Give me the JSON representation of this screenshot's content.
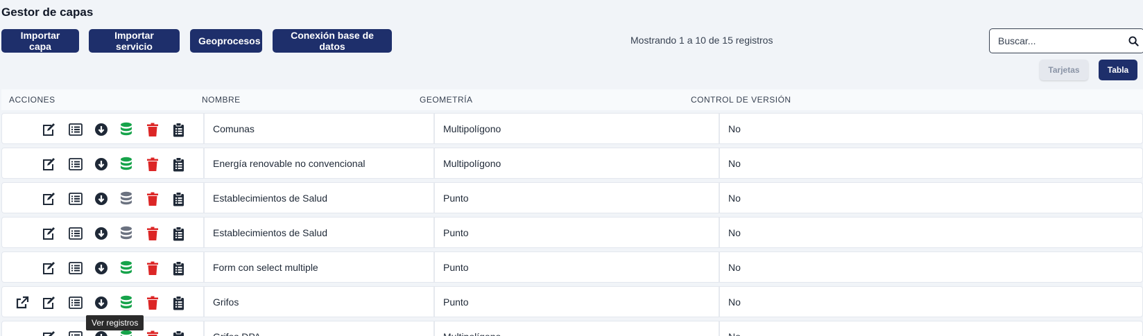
{
  "header": {
    "title": "Gestor de capas"
  },
  "toolbar": {
    "import_layer": "Importar capa",
    "import_service": "Importar servicio",
    "geoprocesses": "Geoprocesos",
    "db_connection": "Conexión base de datos"
  },
  "records_info": "Mostrando 1 a 10 de 15 registros",
  "search": {
    "placeholder": "Buscar...",
    "value": ""
  },
  "view_toggle": {
    "cards": "Tarjetas",
    "table": "Tabla"
  },
  "table": {
    "columns": [
      "ACCIONES",
      "NOMBRE",
      "GEOMETRÍA",
      "CONTROL DE VERSIÓN"
    ],
    "rows": [
      {
        "name": "Comunas",
        "geometry": "Multipolígono",
        "version_control": "No",
        "db_status": "active",
        "external_link": false
      },
      {
        "name": "Energía renovable no convencional",
        "geometry": "Multipolígono",
        "version_control": "No",
        "db_status": "active",
        "external_link": false
      },
      {
        "name": "Establecimientos de Salud",
        "geometry": "Punto",
        "version_control": "No",
        "db_status": "inactive",
        "external_link": false
      },
      {
        "name": "Establecimientos de Salud",
        "geometry": "Punto",
        "version_control": "No",
        "db_status": "inactive",
        "external_link": false
      },
      {
        "name": "Form con select multiple",
        "geometry": "Punto",
        "version_control": "No",
        "db_status": "active",
        "external_link": false
      },
      {
        "name": "Grifos",
        "geometry": "Punto",
        "version_control": "No",
        "db_status": "active",
        "external_link": true
      },
      {
        "name": "Grifos DPA",
        "geometry": "Multipolígono",
        "version_control": "No",
        "db_status": "active",
        "external_link": false
      }
    ]
  },
  "tooltip": "Ver registros",
  "colors": {
    "primary": "#1e2f6b",
    "db_active": "#16a34a",
    "db_inactive": "#6b7280",
    "delete": "#dc2626",
    "icon": "#1f2937"
  },
  "icons": {
    "external": "external-link-icon",
    "edit": "edit-icon",
    "list": "list-icon",
    "download": "download-icon",
    "database": "database-icon",
    "delete": "trash-icon",
    "clipboard": "clipboard-icon",
    "search": "search-icon"
  }
}
